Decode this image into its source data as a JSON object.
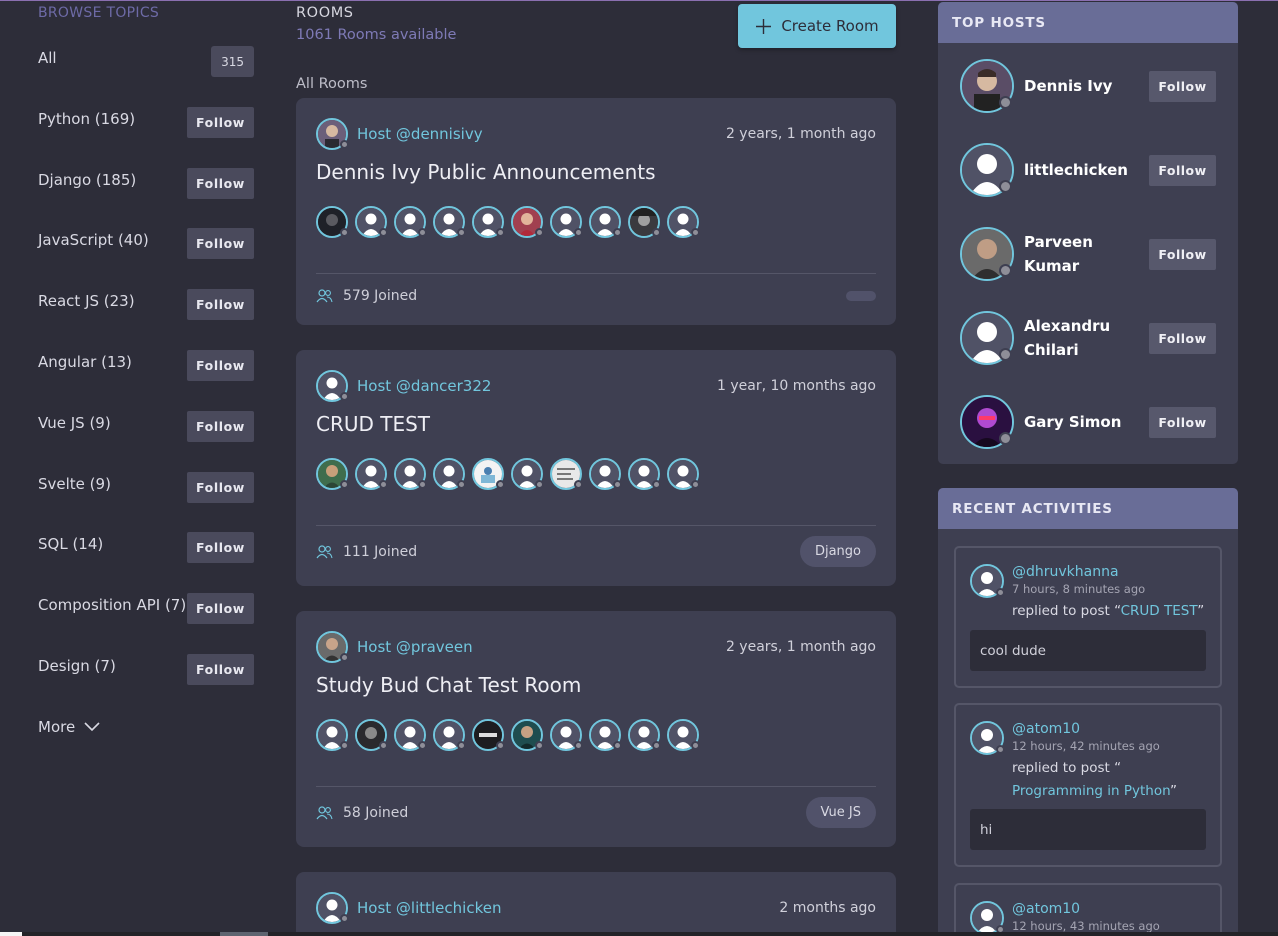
{
  "topics": {
    "title": "BROWSE TOPICS",
    "all_label": "All",
    "all_count": "315",
    "follow_label": "Follow",
    "items": [
      {
        "label": "Python (169)"
      },
      {
        "label": "Django (185)"
      },
      {
        "label": "JavaScript (40)"
      },
      {
        "label": "React JS (23)"
      },
      {
        "label": "Angular (13)"
      },
      {
        "label": "Vue JS (9)"
      },
      {
        "label": "Svelte (9)"
      },
      {
        "label": "SQL (14)"
      },
      {
        "label": "Composition API (7)"
      },
      {
        "label": "Design (7)"
      }
    ],
    "more_label": "More"
  },
  "rooms": {
    "title": "ROOMS",
    "available": "1061 Rooms available",
    "create_label": "Create Room",
    "all_label": "All Rooms",
    "items": [
      {
        "host": "Host @dennisivy",
        "time": "2 years, 1 month ago",
        "title": "Dennis Ivy Public Announcements",
        "joined": "579 Joined",
        "topic": ""
      },
      {
        "host": "Host @dancer322",
        "time": "1 year, 10 months ago",
        "title": "CRUD TEST",
        "joined": "111 Joined",
        "topic": "Django"
      },
      {
        "host": "Host @praveen",
        "time": "2 years, 1 month ago",
        "title": "Study Bud Chat Test Room",
        "joined": "58 Joined",
        "topic": "Vue JS"
      },
      {
        "host": "Host @littlechicken",
        "time": "2 months ago",
        "title": "",
        "joined": "",
        "topic": ""
      }
    ]
  },
  "top_hosts": {
    "title": "TOP HOSTS",
    "follow_label": "Follow",
    "items": [
      {
        "name": "Dennis Ivy"
      },
      {
        "name": "littlechicken"
      },
      {
        "name": "Parveen Kumar"
      },
      {
        "name": "Alexandru Chilari"
      },
      {
        "name": "Gary Simon"
      }
    ]
  },
  "activities": {
    "title": "RECENT ACTIVITIES",
    "items": [
      {
        "user": "@dhruvkhanna",
        "time": "7 hours, 8 minutes ago",
        "prefix": "replied to post “",
        "post": "CRUD TEST",
        "suffix": "”",
        "message": "cool dude"
      },
      {
        "user": "@atom10",
        "time": "12 hours, 42 minutes ago",
        "prefix": "replied to post “",
        "post": "Programming in Python",
        "suffix": "”",
        "message": "hi"
      },
      {
        "user": "@atom10",
        "time": "12 hours, 43 minutes ago",
        "prefix": "",
        "post": "",
        "suffix": "",
        "message": ""
      }
    ]
  },
  "colors": {
    "background": "#2d2d39",
    "card": "#3e3f51",
    "accent": "#71c6dd",
    "panel_header": "#696d97",
    "muted_purple": "#7e7ab6"
  },
  "icons": {
    "create": "plus-icon",
    "joined": "users-icon",
    "more": "chevron-down-icon"
  }
}
